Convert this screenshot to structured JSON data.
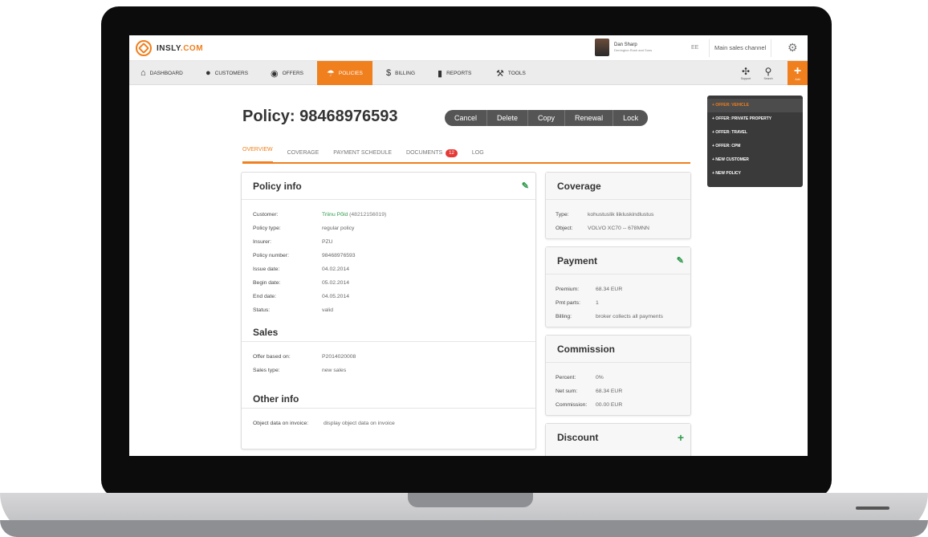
{
  "app": {
    "logo_text": "INSLY",
    "logo_tld": ".COM"
  },
  "user": {
    "name": "Dan Sharp",
    "role": "Derrington Rush and Sons"
  },
  "header": {
    "lang": "EE",
    "channel": "Main sales channel"
  },
  "nav": {
    "items": [
      {
        "label": "DASHBOARD",
        "icon": "home-icon"
      },
      {
        "label": "CUSTOMERS",
        "icon": "user-icon"
      },
      {
        "label": "OFFERS",
        "icon": "offer-icon"
      },
      {
        "label": "POLICIES",
        "icon": "umbrella-icon"
      },
      {
        "label": "BILLING",
        "icon": "dollar-icon"
      },
      {
        "label": "REPORTS",
        "icon": "bar-chart-icon"
      },
      {
        "label": "TOOLS",
        "icon": "wrench-icon"
      }
    ],
    "support": "Support",
    "search": "Search",
    "add": "Add"
  },
  "dropdown": [
    "+ OFFER: VEHICLE",
    "+ OFFER: PRIVATE PROPERTY",
    "+ OFFER: TRAVEL",
    "+ OFFER: CPM",
    "+ NEW CUSTOMER",
    "+ NEW POLICY"
  ],
  "page": {
    "title": "Policy: 98468976593",
    "buttons": [
      "Cancel",
      "Delete",
      "Copy",
      "Renewal",
      "Lock"
    ],
    "tabs": [
      {
        "label": "OVERVIEW"
      },
      {
        "label": "COVERAGE"
      },
      {
        "label": "PAYMENT SCHEDULE"
      },
      {
        "label": "DOCUMENTS",
        "badge": "12"
      },
      {
        "label": "LOG"
      }
    ]
  },
  "policy_info": {
    "title": "Policy info",
    "rows": [
      {
        "k": "Customer:",
        "v": "Triinu Põld",
        "v2": "(48212156019)"
      },
      {
        "k": "Policy type:",
        "v": "regular policy"
      },
      {
        "k": "Insurer:",
        "v": "PZU"
      },
      {
        "k": "Policy number:",
        "v": "98468976593"
      },
      {
        "k": "Issue date:",
        "v": "04.02.2014"
      },
      {
        "k": "Begin date:",
        "v": "05.02.2014"
      },
      {
        "k": "End date:",
        "v": "04.05.2014"
      },
      {
        "k": "Status:",
        "v": "valid"
      }
    ]
  },
  "sales": {
    "title": "Sales",
    "rows": [
      {
        "k": "Offer based on:",
        "v": "P2014020008"
      },
      {
        "k": "Sales type:",
        "v": "new sales"
      }
    ]
  },
  "other": {
    "title": "Other info",
    "rows": [
      {
        "k": "Object data on invoice:",
        "v": "display object data on invoice"
      }
    ]
  },
  "coverage": {
    "title": "Coverage",
    "rows": [
      {
        "k": "Type:",
        "v": "kohustuslik liikluskindlustus"
      },
      {
        "k": "Object:",
        "v": "VOLVO XC70 -- 678MNN"
      }
    ]
  },
  "payment": {
    "title": "Payment",
    "rows": [
      {
        "k": "Premium:",
        "v": "68.34 EUR"
      },
      {
        "k": "Pmt parts:",
        "v": "1"
      },
      {
        "k": "Billing:",
        "v": "broker collects all payments"
      }
    ]
  },
  "commission": {
    "title": "Commission",
    "rows": [
      {
        "k": "Percent:",
        "v": "0%"
      },
      {
        "k": "Net sum:",
        "v": "68.34 EUR"
      },
      {
        "k": "Commission:",
        "v": "00.00 EUR"
      }
    ]
  },
  "discount": {
    "title": "Discount"
  }
}
